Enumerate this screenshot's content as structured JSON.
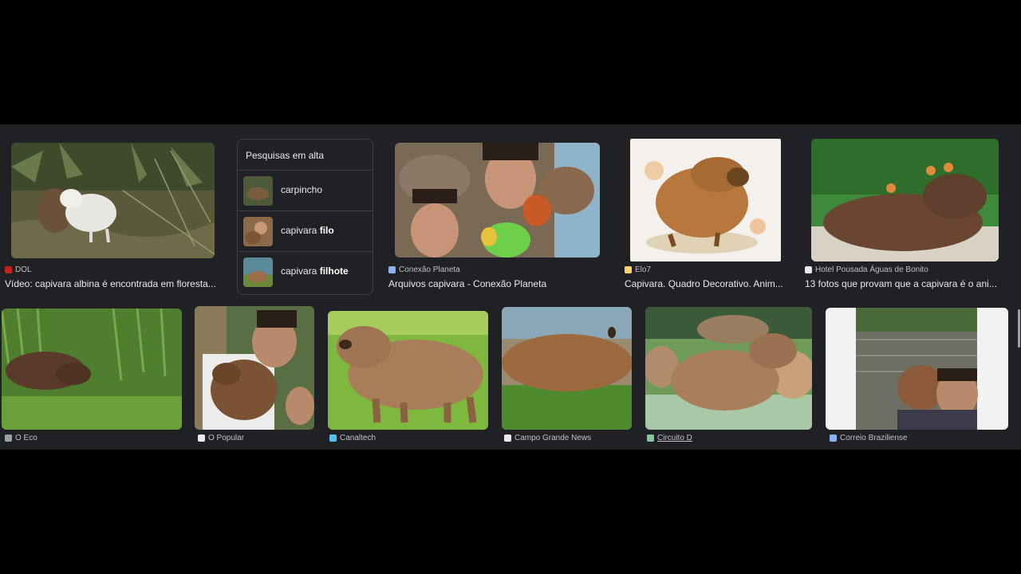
{
  "trending": {
    "title": "Pesquisas em alta",
    "items": [
      {
        "prefix": "carpincho",
        "bold": ""
      },
      {
        "prefix": "capivara ",
        "bold": "filo"
      },
      {
        "prefix": "capivara ",
        "bold": "filhote"
      }
    ]
  },
  "row1": [
    {
      "source": "DOL",
      "title": "Vídeo: capivara albina é encontrada em floresta...",
      "fav_color": "#c5221f"
    },
    {
      "source": "Conexão Planeta",
      "title": "Arquivos capivara - Conexão Planeta",
      "fav_color": "#8ab4f8"
    },
    {
      "source": "Elo7",
      "title": "Capivara. Quadro Decorativo. Anim...",
      "fav_color": "#fdd663"
    },
    {
      "source": "Hotel Pousada Águas de Bonito",
      "title": "13 fotos que provam que a capivara é o ani...",
      "fav_color": "#e8eaed"
    }
  ],
  "row2": [
    {
      "source": "O Eco",
      "fav_color": "#9aa0a6"
    },
    {
      "source": "O Popular",
      "fav_color": "#e8eaed"
    },
    {
      "source": "Canaltech",
      "fav_color": "#4fc3f7"
    },
    {
      "source": "Campo Grande News",
      "fav_color": "#e8eaed"
    },
    {
      "source": "Circuito D",
      "fav_color": "#81c995"
    },
    {
      "source": "Correio Braziliense",
      "fav_color": "#8ab4f8"
    }
  ]
}
